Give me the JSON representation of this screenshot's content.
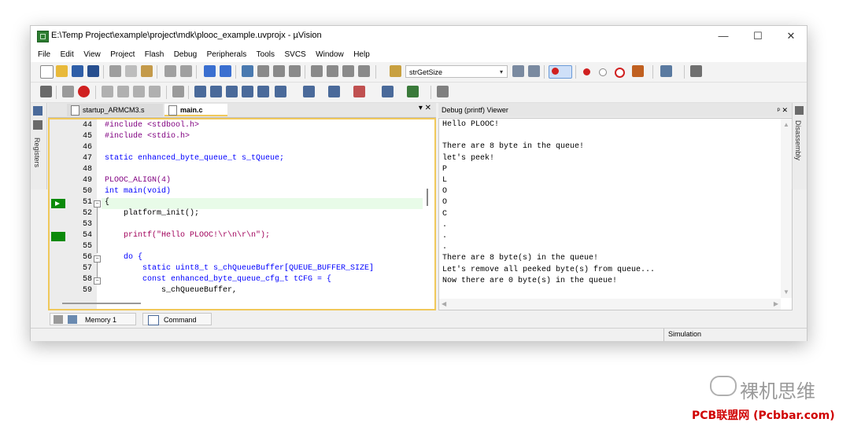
{
  "window": {
    "title": "E:\\Temp Project\\example\\project\\mdk\\plooc_example.uvprojx - µVision",
    "controls": {
      "minimize": "—",
      "maximize": "☐",
      "close": "✕"
    }
  },
  "menu": [
    "File",
    "Edit",
    "View",
    "Project",
    "Flash",
    "Debug",
    "Peripherals",
    "Tools",
    "SVCS",
    "Window",
    "Help"
  ],
  "toolbar": {
    "find_combo_value": "strGetSize"
  },
  "side_panels": {
    "left": "Registers",
    "right": "Disassembly"
  },
  "editor": {
    "tabs": [
      "startup_ARMCM3.s",
      "main.c"
    ],
    "active_tab": "main.c",
    "panel_controls": "▾ ✕",
    "lines": [
      {
        "num": "44",
        "code": "#include <stdbool.h>"
      },
      {
        "num": "45",
        "code": "#include <stdio.h>"
      },
      {
        "num": "46",
        "code": ""
      },
      {
        "num": "47",
        "code": "static enhanced_byte_queue_t s_tQueue;"
      },
      {
        "num": "48",
        "code": ""
      },
      {
        "num": "49",
        "code": "PLOOC_ALIGN(4)"
      },
      {
        "num": "50",
        "code": "int main(void)"
      },
      {
        "num": "51",
        "code": "{"
      },
      {
        "num": "52",
        "code": "    platform_init();"
      },
      {
        "num": "53",
        "code": ""
      },
      {
        "num": "54",
        "code": "    printf(\"Hello PLOOC!\\r\\n\\r\\n\");"
      },
      {
        "num": "55",
        "code": ""
      },
      {
        "num": "56",
        "code": "    do {"
      },
      {
        "num": "57",
        "code": "        static uint8_t s_chQueueBuffer[QUEUE_BUFFER_SIZE]"
      },
      {
        "num": "58",
        "code": "        const enhanced_byte_queue_cfg_t tCFG = {"
      },
      {
        "num": "59",
        "code": "            s_chQueueBuffer,"
      }
    ]
  },
  "debug_viewer": {
    "title": "Debug (printf) Viewer",
    "controls": "ᵖ ✕",
    "lines": [
      "Hello PLOOC!",
      "",
      "There are 8 byte in the queue!",
      "let's peek!",
      "P",
      "L",
      "O",
      "O",
      "C",
      ".",
      ".",
      ".",
      "There are 8 byte(s) in the queue!",
      "Let's remove all peeked byte(s) from queue...",
      "Now there are 0 byte(s) in the queue!"
    ]
  },
  "bottom_tabs": [
    "Memory 1",
    "Command"
  ],
  "status": {
    "mode": "Simulation"
  },
  "watermark": {
    "cn": "裸机思维",
    "url": "PCB联盟网 (Pcbbar.com)"
  },
  "colors": {
    "current_line": "#e8fbe8",
    "exec_marker": "#0a8a0a",
    "editor_border": "#f0c85a",
    "keyword": "#0000ff",
    "string": "#a0005a",
    "preproc": "#800080"
  }
}
